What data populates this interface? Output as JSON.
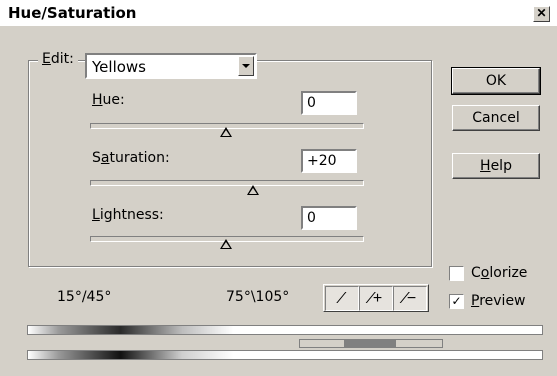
{
  "window": {
    "title": "Hue/Saturation",
    "close_glyph": "✕"
  },
  "edit": {
    "label_underlined": "E",
    "label_rest": "dit:",
    "selected": "Yellows"
  },
  "sliders": {
    "hue": {
      "label_underlined": "H",
      "label_rest": "ue:",
      "value": "0",
      "level": 0.5
    },
    "saturation": {
      "label_pre": "S",
      "label_underlined": "a",
      "label_rest": "turation:",
      "value": "+20",
      "level": 0.6
    },
    "lightness": {
      "label_underlined": "L",
      "label_rest": "ightness:",
      "value": "0",
      "level": 0.5
    }
  },
  "buttons": {
    "ok": "OK",
    "cancel": "Cancel",
    "help_underlined": "H",
    "help_rest": "elp"
  },
  "ranges": {
    "left": "15°/45°",
    "right": "75°\\105°"
  },
  "eyedroppers": {
    "icons": [
      "eyedropper-icon",
      "eyedropper-plus-icon",
      "eyedropper-minus-icon"
    ]
  },
  "options": {
    "colorize": {
      "label_pre": "C",
      "label_underlined": "o",
      "label_rest": "lorize",
      "checked": false
    },
    "preview": {
      "label_underlined": "P",
      "label_rest": "review",
      "checked": true,
      "check_glyph": "✓"
    }
  },
  "colors": {
    "dialog_bg": "#d4d0c8",
    "input_bg": "#ffffff"
  }
}
